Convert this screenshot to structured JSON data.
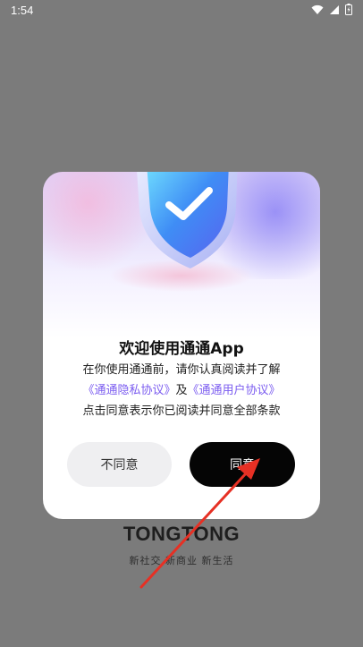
{
  "status_bar": {
    "time": "1:54"
  },
  "brand": {
    "logo": "TONGTONG",
    "slogan": "新社交 新商业 新生活"
  },
  "dialog": {
    "title": "欢迎使用通通App",
    "line1": "在你使用通通前，请你认真阅读并了解",
    "privacy_link": "《通通隐私协议》",
    "and_text": "及",
    "user_link": "《通通用户协议》",
    "line3": "点击同意表示你已阅读并同意全部条款",
    "disagree_label": "不同意",
    "agree_label": "同意"
  },
  "colors": {
    "overlay": "#7b7b7b",
    "link": "#7b5cf0",
    "agree_button": "#050505",
    "disagree_button": "#efeff1",
    "annotation_arrow": "#e63024"
  },
  "icons": [
    "wifi-icon",
    "signal-icon",
    "battery-icon",
    "shield-check-icon",
    "annotation-arrow"
  ]
}
